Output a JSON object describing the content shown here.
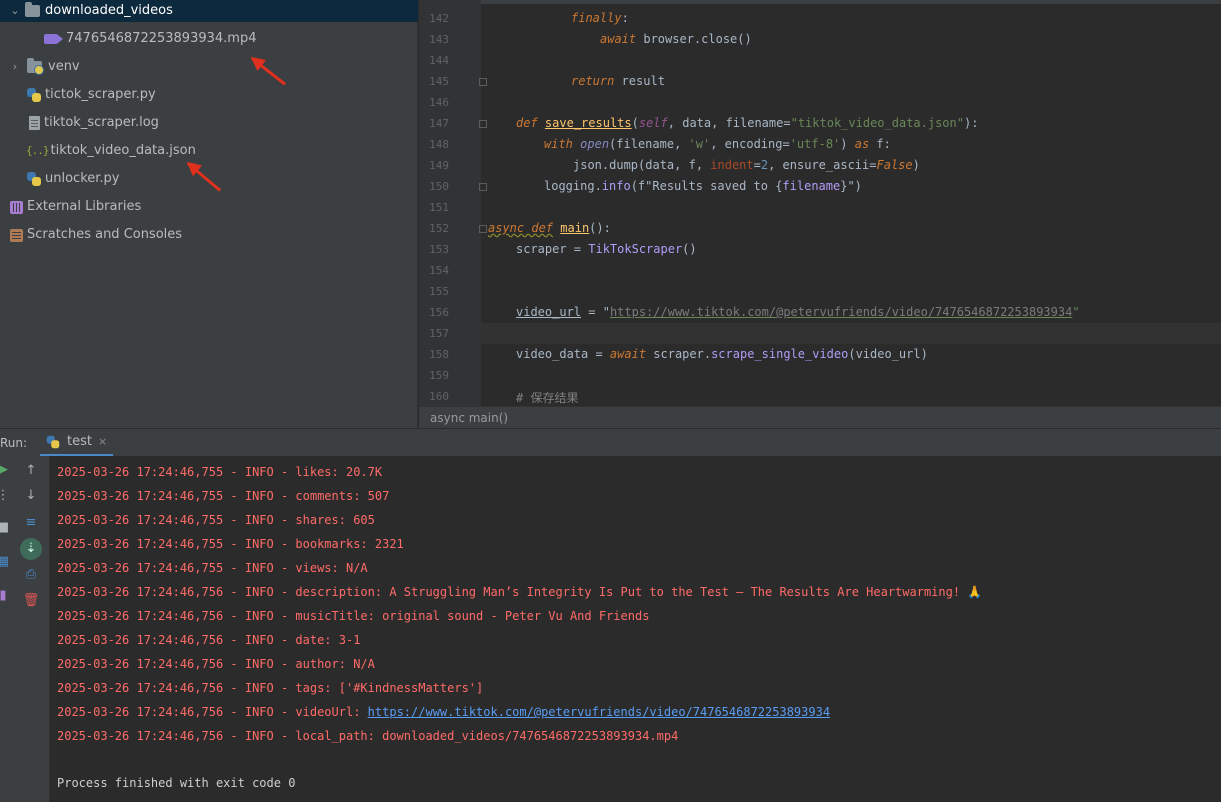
{
  "project_tree": {
    "items": [
      {
        "label": "downloaded_videos",
        "kind": "folder",
        "expanded": true
      },
      {
        "label": "7476546872253893934.mp4",
        "kind": "video"
      },
      {
        "label": "venv",
        "kind": "folder",
        "expanded": false
      },
      {
        "label": "tictok_scraper.py",
        "kind": "python"
      },
      {
        "label": "tiktok_scraper.log",
        "kind": "text"
      },
      {
        "label": "tiktok_video_data.json",
        "kind": "json"
      },
      {
        "label": "unlocker.py",
        "kind": "python"
      },
      {
        "label": "External Libraries",
        "kind": "library"
      },
      {
        "label": "Scratches and Consoles",
        "kind": "scratch"
      }
    ]
  },
  "editor": {
    "line_numbers": [
      "142",
      "143",
      "144",
      "145",
      "146",
      "147",
      "148",
      "149",
      "150",
      "151",
      "152",
      "153",
      "154",
      "155",
      "156",
      "157",
      "158",
      "159",
      "160"
    ],
    "breadcrumb": "async main()",
    "tokens": {
      "finally": "finally",
      "await": "await",
      "browser_close": " browser.close()",
      "return": "return",
      "result": " result",
      "def": "def",
      "save_results": "save_results",
      "lparen": "(",
      "self": "self",
      "data_param": ", data, filename=",
      "json_str": "\"tiktok_video_data.json\"",
      "close_colon": "):",
      "with": "with",
      "open": "open",
      "filename_w": "(filename, ",
      "w_str": "'w'",
      "encoding": ", encoding=",
      "utf8": "'utf-8'",
      "as": "as",
      "f_colon": " f:",
      "json_dump": "json.dump",
      "dump_args": "(data, f, ",
      "indent": "indent",
      "eq2": "=",
      "two": "2",
      "ensure": ", ensure_ascii",
      "false": "False",
      "rparen": ")",
      "logging": "logging.",
      "info": "info",
      "fstr": "(f\"Results saved to {",
      "filename_var": "filename",
      "fstr_end": "}\")",
      "async_def": "async def",
      "main": "main",
      "main_sig": "():",
      "scraper_eq": "scraper = ",
      "TikTokScraper": "TikTokScraper",
      "call": "()",
      "video_url_var": "video_url",
      "eq_q": " = \"",
      "url": "https://www.tiktok.com/@petervufriends/video/7476546872253893934",
      "q": "\"",
      "video_data_eq": "video_data = ",
      "scraper_dot": " scraper.",
      "scrape_single_video": "scrape_single_video",
      "video_url_arg": "(video_url)",
      "comment_save": "# 保存结果"
    }
  },
  "run_panel": {
    "label": "Run:",
    "tab_label": "test",
    "close_glyph": "×",
    "log_lines": [
      "2025-03-26 17:24:46,755 - INFO - likes: 20.7K",
      "2025-03-26 17:24:46,755 - INFO - comments: 507",
      "2025-03-26 17:24:46,755 - INFO - shares: 605",
      "2025-03-26 17:24:46,755 - INFO - bookmarks: 2321",
      "2025-03-26 17:24:46,755 - INFO - views: N/A",
      "2025-03-26 17:24:46,756 - INFO - description: A Struggling Man’s Integrity Is Put to the Test – The Results Are Heartwarming! 🙏",
      "2025-03-26 17:24:46,756 - INFO - musicTitle: original sound - Peter Vu And Friends",
      "2025-03-26 17:24:46,756 - INFO - date: 3-1",
      "2025-03-26 17:24:46,756 - INFO - author: N/A",
      "2025-03-26 17:24:46,756 - INFO - tags: ['#KindnessMatters']"
    ],
    "video_url_prefix": "2025-03-26 17:24:46,756 - INFO - videoUrl: ",
    "video_url_link": "https://www.tiktok.com/@petervufriends/video/7476546872253893934",
    "local_path_line": "2025-03-26 17:24:46,756 - INFO - local_path: downloaded_videos/7476546872253893934.mp4",
    "exit_message": "Process finished with exit code 0"
  },
  "colors": {
    "log_text": "#ff6b68",
    "link": "#589df6",
    "annotation_arrow": "#e0301e",
    "panel_bg": "#3c3f41",
    "editor_bg": "#2b2b2b"
  }
}
